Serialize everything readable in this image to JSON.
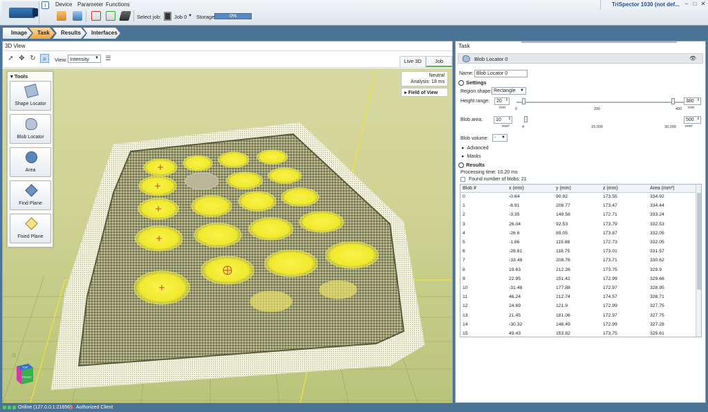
{
  "menu": {
    "device": "Device",
    "parameter": "Parameter",
    "functions": "Functions"
  },
  "toolbar": {
    "select_job_label": "Select job:",
    "job_value": "Job 0",
    "storage_label": "Storage",
    "storage_value": "0%",
    "storage_fill": 0
  },
  "app_title": "TriSpector 1030 (not def...",
  "nav_tabs": [
    "Image",
    "Task",
    "Results",
    "Interfaces"
  ],
  "left": {
    "title": "3D View",
    "view_label": "View:",
    "view_value": "Intensity",
    "view_tabs": [
      "Live 3D",
      "Job"
    ],
    "tools_title": "Tools",
    "tools": [
      "Shape Locator",
      "Blob Locator",
      "Area",
      "Find Plane",
      "Fixed Plane"
    ],
    "info_line1": "Neutral",
    "info_line2": "Analysis: 18 ms",
    "fov_label": "Field of View",
    "cube_top": "TOP",
    "cube_front": "FRONT"
  },
  "right": {
    "title": "Task",
    "header": "Blob Locator 0",
    "name_label": "Name:",
    "name_value": "Blob Locator 0",
    "settings": "Settings",
    "region_shape_label": "Region shape:",
    "region_shape_value": "Rectangle",
    "height_range_label": "Height range:",
    "height_min": "20",
    "height_max": "380",
    "height_unit": "mm",
    "height_ticks": [
      "0",
      "200",
      "400"
    ],
    "blob_area_label": "Blob area:",
    "area_min": "10",
    "area_max": "500",
    "area_unit": "mm²",
    "area_ticks": [
      "4",
      "15,000",
      "30,000"
    ],
    "blob_volume_label": "Blob volume:",
    "blob_volume_value": "-",
    "advanced": "Advanced",
    "masks": "Masks",
    "results": "Results",
    "processing_time": "Processing time: 10.20 ms",
    "found_blobs": "Found number of blobs: 21",
    "table_headers": [
      "Blob #",
      "x (mm)",
      "y (mm)",
      "z (mm)",
      "Area (mm²)"
    ],
    "table_rows": [
      [
        "0",
        "-0.64",
        "90.92",
        "173.55",
        "334.92"
      ],
      [
        "1",
        "-6.91",
        "208.77",
        "173.47",
        "334.44"
      ],
      [
        "2",
        "-3.35",
        "149.58",
        "172.71",
        "333.24"
      ],
      [
        "3",
        "26.04",
        "92.53",
        "173.79",
        "332.53"
      ],
      [
        "4",
        "-26.6",
        "89.05",
        "173.87",
        "332.05"
      ],
      [
        "5",
        "-1.86",
        "119.88",
        "172.73",
        "332.05"
      ],
      [
        "6",
        "-28.81",
        "118.75",
        "173.01",
        "331.57"
      ],
      [
        "7",
        "-33.48",
        "208.76",
        "173.71",
        "330.62"
      ],
      [
        "8",
        "19.63",
        "212.26",
        "173.75",
        "329.9"
      ],
      [
        "9",
        "22.95",
        "151.42",
        "172.99",
        "329.66"
      ],
      [
        "10",
        "-31.48",
        "177.88",
        "172.97",
        "328.95"
      ],
      [
        "11",
        "46.24",
        "212.74",
        "174.57",
        "328.71"
      ],
      [
        "12",
        "24.69",
        "121.9",
        "172.99",
        "327.75"
      ],
      [
        "13",
        "21.45",
        "181.06",
        "172.97",
        "327.75"
      ],
      [
        "14",
        "-30.32",
        "148.49",
        "172.99",
        "327.28"
      ],
      [
        "15",
        "49.43",
        "153.82",
        "173.75",
        "325.61"
      ]
    ]
  },
  "status": {
    "connection": "Online (127.0.0.1:21656)",
    "client": "Authorized Client"
  }
}
